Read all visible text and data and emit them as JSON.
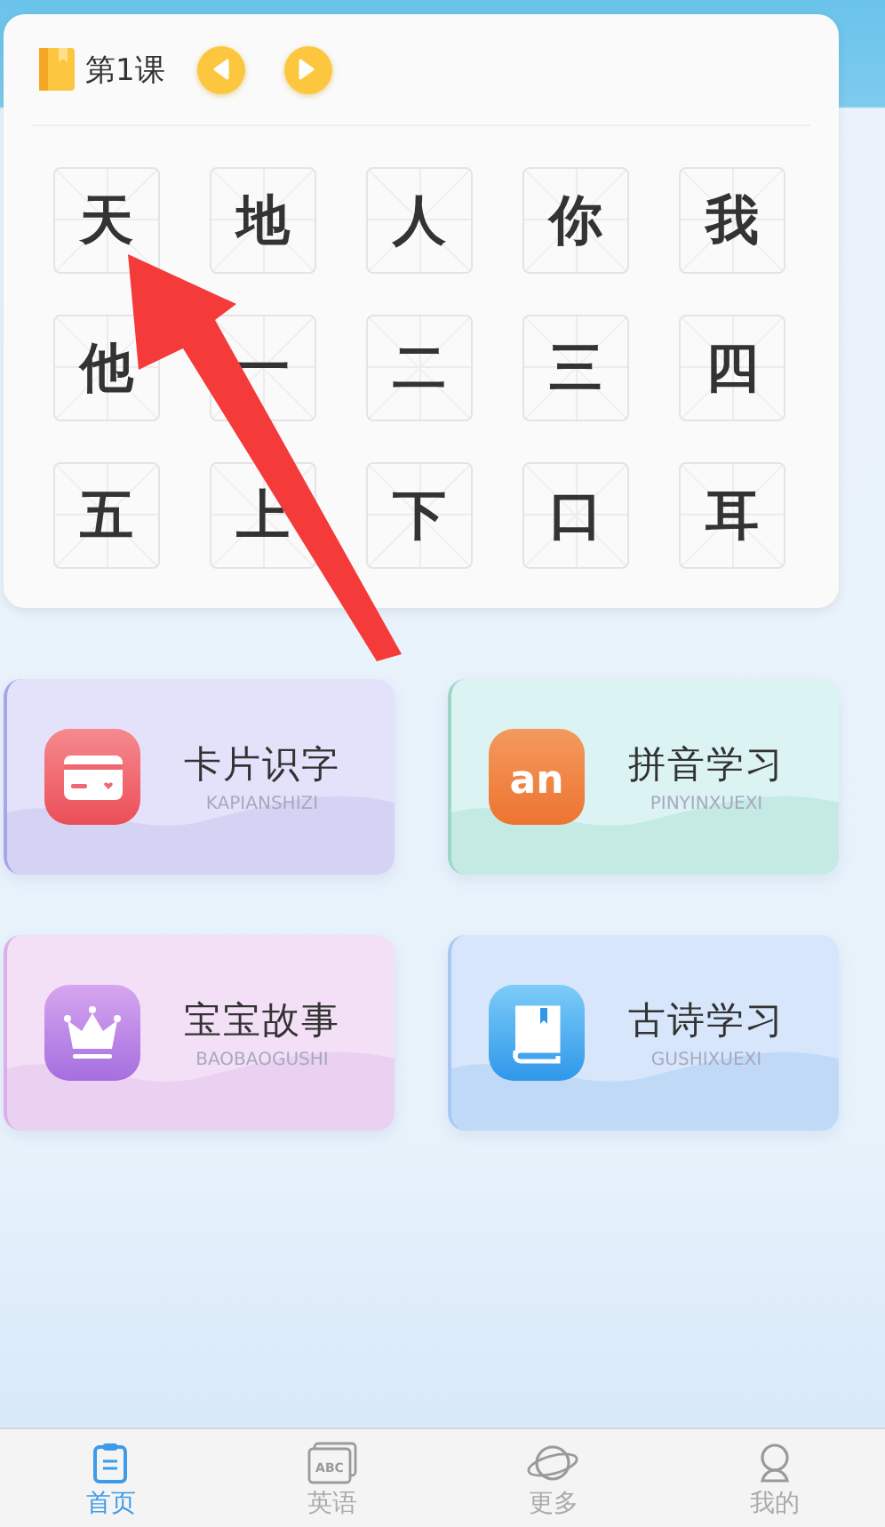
{
  "lesson": {
    "title": "第1课"
  },
  "characters": [
    "天",
    "地",
    "人",
    "你",
    "我",
    "他",
    "一",
    "二",
    "三",
    "四",
    "五",
    "上",
    "下",
    "口",
    "耳"
  ],
  "features": [
    {
      "kind": "card",
      "title": "卡片识字",
      "subtitle": "KAPIANSHIZI"
    },
    {
      "kind": "pinyin",
      "title": "拼音学习",
      "subtitle": "PINYINXUEXI",
      "icon_text": "an"
    },
    {
      "kind": "crown",
      "title": "宝宝故事",
      "subtitle": "BAOBAOGUSHI"
    },
    {
      "kind": "book",
      "title": "古诗学习",
      "subtitle": "GUSHIXUEXI"
    }
  ],
  "tabs": [
    {
      "kind": "home",
      "label": "首页",
      "selected": true
    },
    {
      "kind": "abc",
      "label": "英语",
      "selected": false,
      "icon_text": "ABC"
    },
    {
      "kind": "planet",
      "label": "更多",
      "selected": false
    },
    {
      "kind": "profile",
      "label": "我的",
      "selected": false
    }
  ]
}
